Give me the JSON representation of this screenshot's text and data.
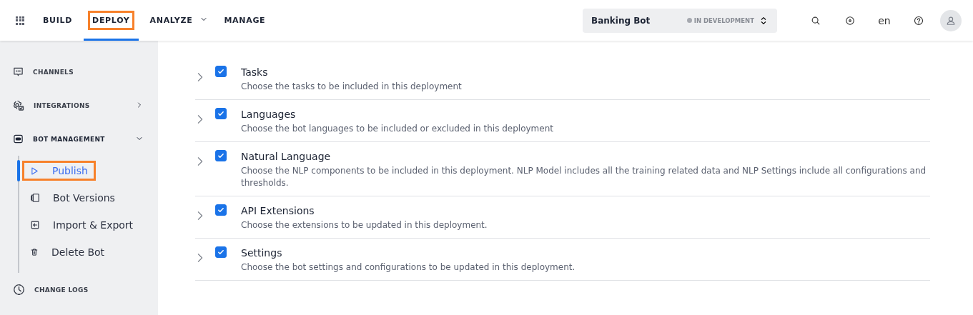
{
  "nav": {
    "tabs": [
      {
        "label": "BUILD",
        "selected": false,
        "highlighted": false,
        "has_menu": false
      },
      {
        "label": "DEPLOY",
        "selected": true,
        "highlighted": true,
        "has_menu": false
      },
      {
        "label": "ANALYZE",
        "selected": false,
        "highlighted": false,
        "has_menu": true
      },
      {
        "label": "MANAGE",
        "selected": false,
        "highlighted": false,
        "has_menu": false
      }
    ]
  },
  "bot_selector": {
    "name": "Banking Bot",
    "status": "IN DEVELOPMENT"
  },
  "language": "en",
  "sidebar": {
    "items": [
      {
        "kind": "link",
        "label": "CHANNELS",
        "selected": false
      },
      {
        "kind": "group",
        "label": "INTEGRATIONS",
        "expanded": false,
        "selected": false
      },
      {
        "kind": "group",
        "label": "BOT MANAGEMENT",
        "expanded": true,
        "selected": true,
        "children": [
          {
            "label": "Publish",
            "selected": true,
            "highlighted": true
          },
          {
            "label": "Bot Versions",
            "selected": false,
            "highlighted": false
          },
          {
            "label": "Import & Export",
            "selected": false,
            "highlighted": false
          },
          {
            "label": "Delete Bot",
            "selected": false,
            "highlighted": false
          }
        ]
      },
      {
        "kind": "link",
        "label": "CHANGE LOGS",
        "selected": false
      }
    ]
  },
  "sections": [
    {
      "title": "Tasks",
      "description": "Choose the tasks to be included in this deployment",
      "checked": true,
      "expanded": false
    },
    {
      "title": "Languages",
      "description": "Choose the bot languages to be included or excluded in this deployment",
      "checked": true,
      "expanded": false
    },
    {
      "title": "Natural Language",
      "description": "Choose the NLP components to be included in this deployment. NLP Model includes all the training related data and NLP Settings include all configurations and thresholds.",
      "checked": true,
      "expanded": false
    },
    {
      "title": "API Extensions",
      "description": "Choose the extensions to be updated in this deployment.",
      "checked": true,
      "expanded": false
    },
    {
      "title": "Settings",
      "description": "Choose the bot settings and configurations to be updated in this deployment.",
      "checked": true,
      "expanded": false
    }
  ]
}
